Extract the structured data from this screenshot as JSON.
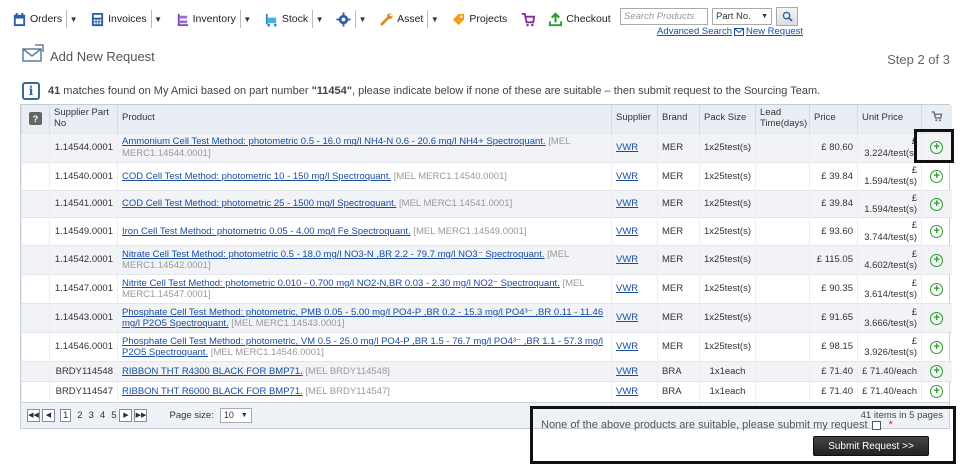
{
  "toolbar": {
    "orders": "Orders",
    "invoices": "Invoices",
    "inventory": "Inventory",
    "stock": "Stock",
    "asset": "Asset",
    "projects": "Projects",
    "checkout": "Checkout",
    "search_placeholder": "Search Products",
    "search_mode": "Part No.",
    "advanced_search": "Advanced Search",
    "new_request": "New Request"
  },
  "page": {
    "title": "Add New Request",
    "step": "Step 2 of 3",
    "info_count": "41",
    "info_text_1": " matches found on My Amici based on part number ",
    "info_part": "\"11454\"",
    "info_text_2": ", please indicate below if none of these are suitable – then submit request to the Sourcing Team."
  },
  "table": {
    "headers": {
      "supplier_part_no": "Supplier Part No",
      "product": "Product",
      "supplier": "Supplier",
      "brand": "Brand",
      "pack_size": "Pack Size",
      "lead_time": "Lead Time(days)",
      "price": "Price",
      "unit_price": "Unit Price"
    },
    "rows": [
      {
        "part": "1.14544.0001",
        "product": "Ammonium Cell Test Method: photometric 0.5 - 16.0 mg/l NH4-N 0.6 - 20.6 mg/l NH4+ Spectroquant.",
        "mel": " [MEL MERC1.14544.0001]",
        "supplier": "VWR",
        "brand": "MER",
        "pack": "1x25test(s)",
        "lead": "",
        "price": "£ 80.60",
        "unit": "£ 3.224/test(s)"
      },
      {
        "part": "1.14540.0001",
        "product": "COD Cell Test Method: photometric 10 - 150 mg/l Spectroquant.",
        "mel": " [MEL MERC1.14540.0001]",
        "supplier": "VWR",
        "brand": "MER",
        "pack": "1x25test(s)",
        "lead": "",
        "price": "£ 39.84",
        "unit": "£ 1.594/test(s)"
      },
      {
        "part": "1.14541.0001",
        "product": "COD Cell Test Method: photometric 25 - 1500 mg/l Spectroquant.",
        "mel": " [MEL MERC1.14541.0001]",
        "supplier": "VWR",
        "brand": "MER",
        "pack": "1x25test(s)",
        "lead": "",
        "price": "£ 39.84",
        "unit": "£ 1.594/test(s)"
      },
      {
        "part": "1.14549.0001",
        "product": "Iron Cell Test Method: photometric 0.05 - 4.00 mg/l Fe Spectroquant.",
        "mel": " [MEL MERC1.14549.0001]",
        "supplier": "VWR",
        "brand": "MER",
        "pack": "1x25test(s)",
        "lead": "",
        "price": "£ 93.60",
        "unit": "£ 3.744/test(s)"
      },
      {
        "part": "1.14542.0001",
        "product": "Nitrate Cell Test Method: photometric 0.5 - 18.0 mg/l NO3-N ,BR 2.2 - 79.7 mg/l NO3⁻ Spectroquant.",
        "mel": " [MEL MERC1.14542.0001]",
        "supplier": "VWR",
        "brand": "MER",
        "pack": "1x25test(s)",
        "lead": "",
        "price": "£ 115.05",
        "unit": "£ 4.602/test(s)"
      },
      {
        "part": "1.14547.0001",
        "product": "Nitrite Cell Test Method: photometric 0.010 - 0.700 mg/l NO2-N,BR 0.03 - 2.30 mg/l NO2⁻ Spectroquant.",
        "mel": " [MEL MERC1.14547.0001]",
        "supplier": "VWR",
        "brand": "MER",
        "pack": "1x25test(s)",
        "lead": "",
        "price": "£ 90.35",
        "unit": "£ 3.614/test(s)"
      },
      {
        "part": "1.14543.0001",
        "product": "Phosphate Cell Test Method: photometric, PMB 0.05 - 5.00 mg/l PO4-P ,BR 0.2 - 15.3 mg/l PO4³⁻ ,BR 0.11 - 11.46 mg/l P2O5 Spectroquant.",
        "mel": " [MEL MERC1.14543.0001]",
        "supplier": "VWR",
        "brand": "MER",
        "pack": "1x25test(s)",
        "lead": "",
        "price": "£ 91.65",
        "unit": "£ 3.666/test(s)"
      },
      {
        "part": "1.14546.0001",
        "product": "Phosphate Cell Test Method: photometric, VM 0.5 - 25.0 mg/l PO4-P ,BR 1.5 - 76.7 mg/l PO4³⁻ ,BR 1.1 - 57.3 mg/l P2O5 Spectroquant.",
        "mel": " [MEL MERC1.14546.0001]",
        "supplier": "VWR",
        "brand": "MER",
        "pack": "1x25test(s)",
        "lead": "",
        "price": "£ 98.15",
        "unit": "£ 3.926/test(s)"
      },
      {
        "part": "BRDY114548",
        "product": "RIBBON THT R4300 BLACK FOR BMP71.",
        "mel": " [MEL BRDY114548]",
        "supplier": "VWR",
        "brand": "BRA",
        "pack": "1x1each",
        "lead": "",
        "price": "£ 71.40",
        "unit": "£ 71.40/each"
      },
      {
        "part": "BRDY114547",
        "product": "RIBBON THT R6000 BLACK FOR BMP71.",
        "mel": " [MEL BRDY114547]",
        "supplier": "VWR",
        "brand": "BRA",
        "pack": "1x1each",
        "lead": "",
        "price": "£ 71.40",
        "unit": "£ 71.40/each"
      }
    ]
  },
  "pager": {
    "pages": [
      "1",
      "2",
      "3",
      "4",
      "5"
    ],
    "page_size_label": "Page size:",
    "page_size": "10",
    "info": "41 items in 5 pages"
  },
  "footer": {
    "none_suitable": "None of the above products are suitable, please submit my request",
    "required": "*",
    "submit": "Submit Request >>"
  },
  "colors": {
    "link": "#1a4ea0",
    "add_green": "#2a9a2a",
    "header_bg": "#e9eef4"
  }
}
